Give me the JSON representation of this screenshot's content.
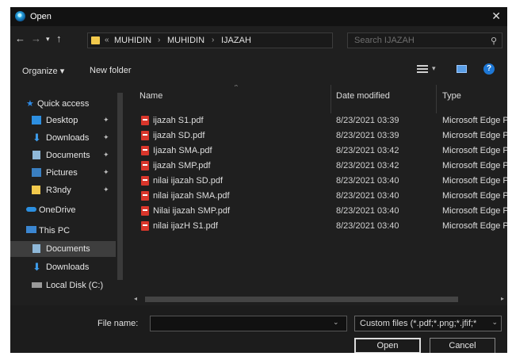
{
  "title": "Open",
  "address": {
    "overflow_chevron": "«",
    "crumbs": [
      "MUHIDIN",
      "MUHIDIN",
      "IJAZAH"
    ],
    "separator": "›"
  },
  "search": {
    "placeholder": "Search IJAZAH"
  },
  "toolbar": {
    "organize": "Organize ▾",
    "new_folder": "New folder"
  },
  "sidebar": {
    "quick_access": "Quick access",
    "items": [
      {
        "label": "Desktop",
        "pinned": true
      },
      {
        "label": "Downloads",
        "pinned": true
      },
      {
        "label": "Documents",
        "pinned": true
      },
      {
        "label": "Pictures",
        "pinned": true
      },
      {
        "label": "R3ndy",
        "pinned": true
      }
    ],
    "onedrive": "OneDrive",
    "this_pc": "This PC",
    "pc_items": [
      "Documents",
      "Downloads",
      "Local Disk (C:)"
    ]
  },
  "columns": {
    "name": "Name",
    "date": "Date modified",
    "type": "Type"
  },
  "files": [
    {
      "name": "ijazah S1.pdf",
      "date": "8/23/2021 03:39",
      "type": "Microsoft Edge P"
    },
    {
      "name": "ijazah SD.pdf",
      "date": "8/23/2021 03:39",
      "type": "Microsoft Edge P"
    },
    {
      "name": "Ijazah SMA.pdf",
      "date": "8/23/2021 03:42",
      "type": "Microsoft Edge P"
    },
    {
      "name": "ijazah SMP.pdf",
      "date": "8/23/2021 03:42",
      "type": "Microsoft Edge P"
    },
    {
      "name": "nilai ijazah SD.pdf",
      "date": "8/23/2021 03:40",
      "type": "Microsoft Edge P"
    },
    {
      "name": "nilai ijazah SMA.pdf",
      "date": "8/23/2021 03:40",
      "type": "Microsoft Edge P"
    },
    {
      "name": "Nilai ijazah SMP.pdf",
      "date": "8/23/2021 03:40",
      "type": "Microsoft Edge P"
    },
    {
      "name": "nilai ijazH S1.pdf",
      "date": "8/23/2021 03:40",
      "type": "Microsoft Edge P"
    }
  ],
  "footer": {
    "file_name_label": "File name:",
    "file_name_value": "",
    "file_type": "Custom files (*.pdf;*.png;*.jfif;*",
    "open": "Open",
    "cancel": "Cancel"
  },
  "colors": {
    "background": "#1f1f1f",
    "titlebar": "#121212",
    "selection": "#3e3e3e",
    "pdf_icon": "#d9362b",
    "accent": "#1e78d6"
  }
}
